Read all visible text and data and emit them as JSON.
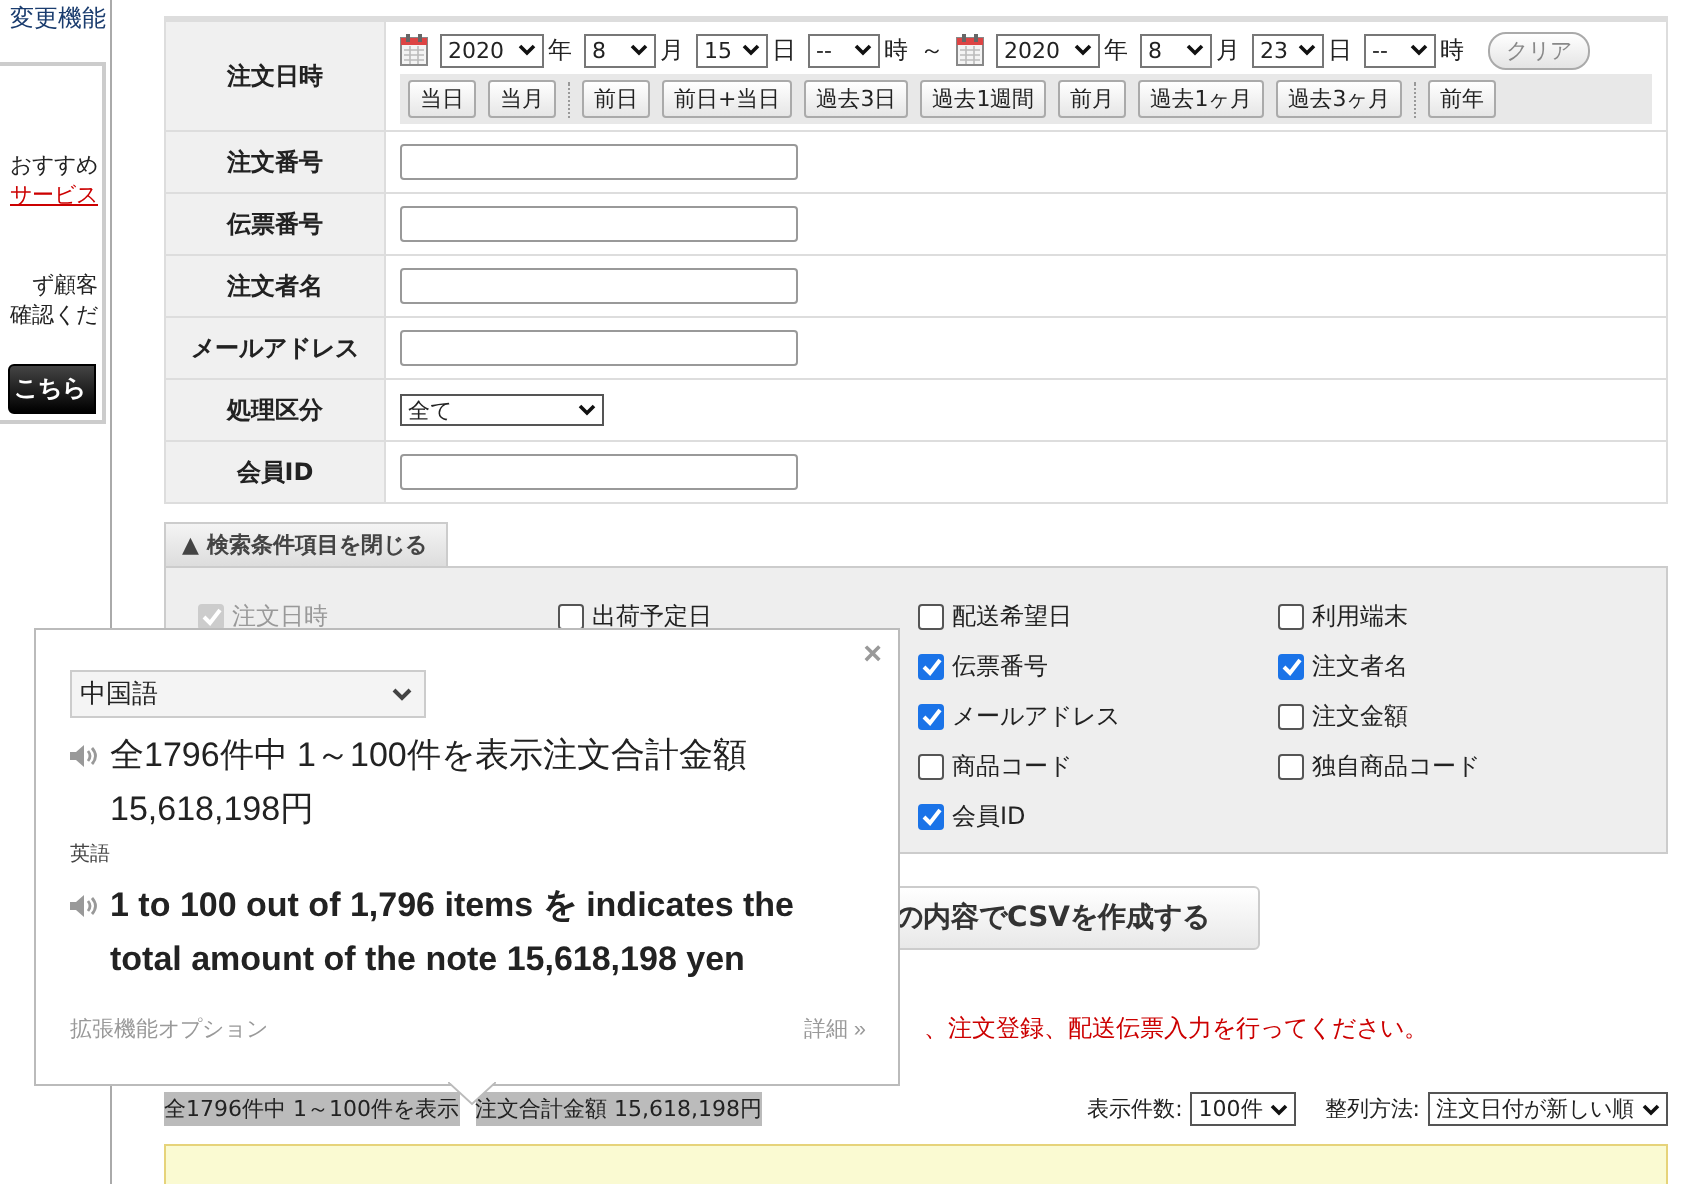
{
  "sidebar": {
    "items": [
      {
        "kind": "text",
        "text": "変更機能"
      },
      {
        "kind": "text",
        "text": "おすすめ"
      },
      {
        "kind": "link",
        "text": "サービス"
      },
      {
        "kind": "text",
        "text": "ず顧客"
      },
      {
        "kind": "text",
        "text": "確認くだ"
      },
      {
        "kind": "button",
        "text": "こちら"
      }
    ]
  },
  "search_form": {
    "date_row": {
      "label": "注文日時",
      "from": {
        "year": "2020",
        "year_unit": "年",
        "month": "8",
        "month_unit": "月",
        "day": "15",
        "day_unit": "日",
        "hour": "--",
        "hour_unit": "時"
      },
      "separator": "～",
      "to": {
        "year": "2020",
        "year_unit": "年",
        "month": "8",
        "month_unit": "月",
        "day": "23",
        "day_unit": "日",
        "hour": "--",
        "hour_unit": "時"
      },
      "clear_button": "クリア",
      "quick_buttons": [
        [
          "当日",
          "当月"
        ],
        [
          "前日",
          "前日+当日",
          "過去3日",
          "過去1週間",
          "前月",
          "過去1ヶ月",
          "過去3ヶ月"
        ],
        [
          "前年"
        ]
      ]
    },
    "rows": [
      {
        "label": "注文番号",
        "kind": "input",
        "value": ""
      },
      {
        "label": "伝票番号",
        "kind": "input",
        "value": ""
      },
      {
        "label": "注文者名",
        "kind": "input",
        "value": ""
      },
      {
        "label": "メールアドレス",
        "kind": "input",
        "value": ""
      },
      {
        "label": "処理区分",
        "kind": "select",
        "value": "全て"
      },
      {
        "label": "会員ID",
        "kind": "input",
        "value": ""
      }
    ]
  },
  "toggle_tab": {
    "icon": "▲",
    "label": "検索条件項目を閉じる"
  },
  "columns_options": [
    [
      {
        "label": "注文日時",
        "checked": true,
        "disabled": true
      }
    ],
    [
      {
        "label": "出荷予定日",
        "checked": false,
        "disabled": false
      }
    ],
    [
      {
        "label": "配送希望日",
        "checked": false,
        "disabled": false
      },
      {
        "label": "伝票番号",
        "checked": true,
        "disabled": false
      },
      {
        "label": "メールアドレス",
        "checked": true,
        "disabled": false
      },
      {
        "label": "商品コード",
        "checked": false,
        "disabled": false
      },
      {
        "label": "会員ID",
        "checked": true,
        "disabled": false
      }
    ],
    [
      {
        "label": "利用端末",
        "checked": false,
        "disabled": false
      },
      {
        "label": "注文者名",
        "checked": true,
        "disabled": false
      },
      {
        "label": "注文金額",
        "checked": false,
        "disabled": false
      },
      {
        "label": "独自商品コード",
        "checked": false,
        "disabled": false
      }
    ]
  ],
  "csv_button": "の内容でCSVを作成する",
  "notice": "、注文登録、配送伝票入力を行ってください。",
  "summary": [
    {
      "text": "全1796件中 1～100件を表示",
      "highlighted": true
    },
    {
      "text": "注文合計金額 15,618,198円",
      "highlighted": true
    }
  ],
  "per_page": {
    "label": "表示件数:",
    "value": "100件"
  },
  "sort": {
    "label": "整列方法:",
    "value": "注文日付が新しい順"
  },
  "translate_popup": {
    "close": "×",
    "source_language": "中国語",
    "source_text": "全1796件中 1～100件を表示注文合計金額 15,618,198円",
    "target_language": "英語",
    "translation": "1 to 100 out of 1,796 items を indicates the total amount of the note 15,618,198 yen",
    "options_link": "拡張機能オプション",
    "details_link": "詳細 »"
  }
}
